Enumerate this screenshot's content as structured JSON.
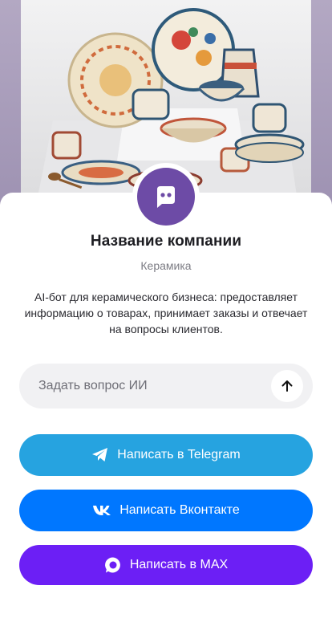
{
  "company": {
    "name": "Название компании",
    "category": "Керамика",
    "description": "AI-бот для керамического бизнеса: предоставляет информацию о товарах, принимает заказы и отвечает на вопросы клиентов."
  },
  "ask": {
    "placeholder": "Задать вопрос ИИ"
  },
  "buttons": {
    "telegram": "Написать в Telegram",
    "vk": "Написать Вконтакте",
    "max": "Написать в MAX"
  },
  "colors": {
    "avatar": "#6d4ba6",
    "telegram": "#26a3e0",
    "vk": "#0077ff",
    "max": "#6c1ff5"
  },
  "icons": {
    "avatar": "chat-bubble-icon",
    "send": "arrow-up-icon",
    "telegram": "telegram-icon",
    "vk": "vk-icon",
    "max": "max-icon"
  }
}
